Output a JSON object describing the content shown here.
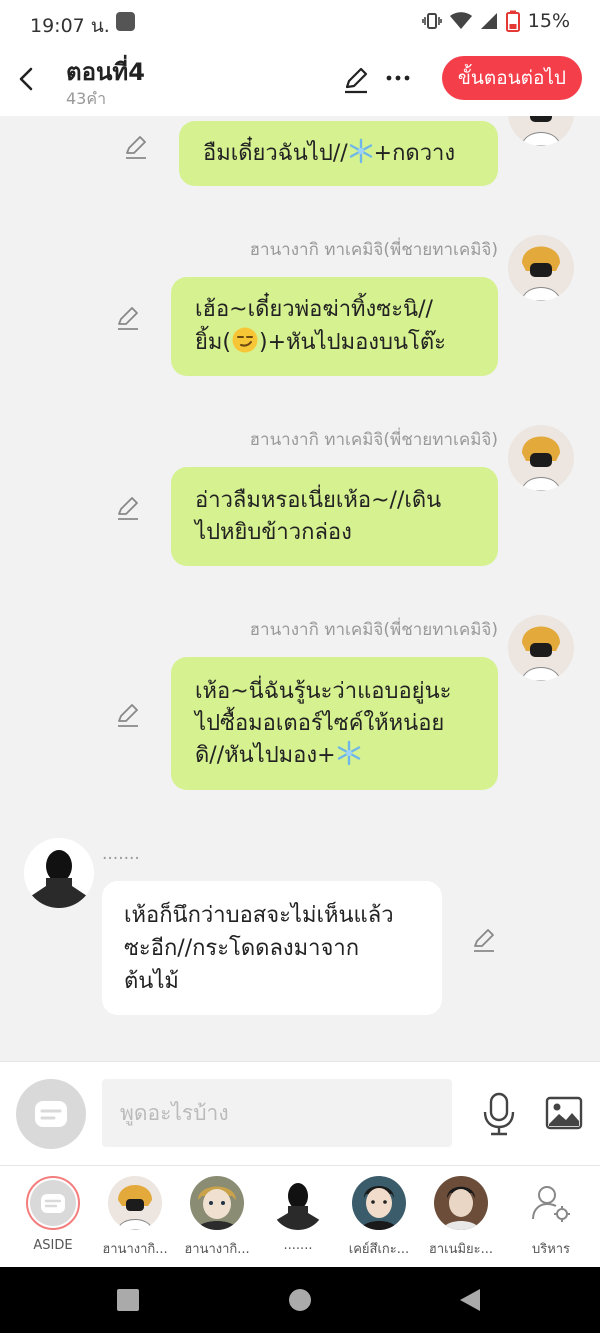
{
  "status_bar": {
    "time": "19:07 น.",
    "battery": "15%"
  },
  "header": {
    "title": "ตอนที่4",
    "subtitle": "43คำ",
    "next_label": "ขั้นตอนต่อไป"
  },
  "messages": [
    {
      "side": "right",
      "sender": "",
      "text": "อืมเดี๋ยวฉันไป//",
      "text_after": "+กดวาง"
    },
    {
      "side": "right",
      "sender": "ฮานางากิ ทาเคมิจิ(พี่ชายทาเคมิจิ)",
      "line1": "เฮ้อ~เดี๋ยวพ่อฆ่าทิ้งซะนิ//",
      "line2_a": "ยิ้ม(",
      "line2_b": ")+หันไปมองบนโต๊ะ"
    },
    {
      "side": "right",
      "sender": "ฮานางากิ ทาเคมิจิ(พี่ชายทาเคมิจิ)",
      "line1": "อ่าวลืมหรอเนี่ยเห้อ~//เดิน",
      "line2": "ไปหยิบข้าวกล่อง"
    },
    {
      "side": "right",
      "sender": "ฮานางากิ ทาเคมิจิ(พี่ชายทาเคมิจิ)",
      "line1": "เห้อ~นี่ฉันรู้นะว่าแอบอยู่นะ",
      "line2": "ไปซื้อมอเตอร์ไซค์ให้หน่อย",
      "line3": "ดิ//หันไปมอง+"
    },
    {
      "side": "left",
      "sender": ".......",
      "line1": "เห้อก็นึกว่าบอสจะไม่เห็นแล้ว",
      "line2": "ซะอีก//กระโดดลงมาจาก",
      "line3": "ต้นไม้"
    }
  ],
  "composer": {
    "placeholder": "พูดอะไรบ้าง"
  },
  "characters": [
    {
      "label": "ASIDE"
    },
    {
      "label": "ฮานางากิ..."
    },
    {
      "label": "ฮานางากิ..."
    },
    {
      "label": "......."
    },
    {
      "label": "เคย์สึเกะ..."
    },
    {
      "label": "ฮาเนมิยะ..."
    },
    {
      "label": "บริหาร"
    }
  ],
  "colors": {
    "accent": "#f43f4b",
    "bubble_right": "#d6f190",
    "bubble_left": "#ffffff"
  }
}
